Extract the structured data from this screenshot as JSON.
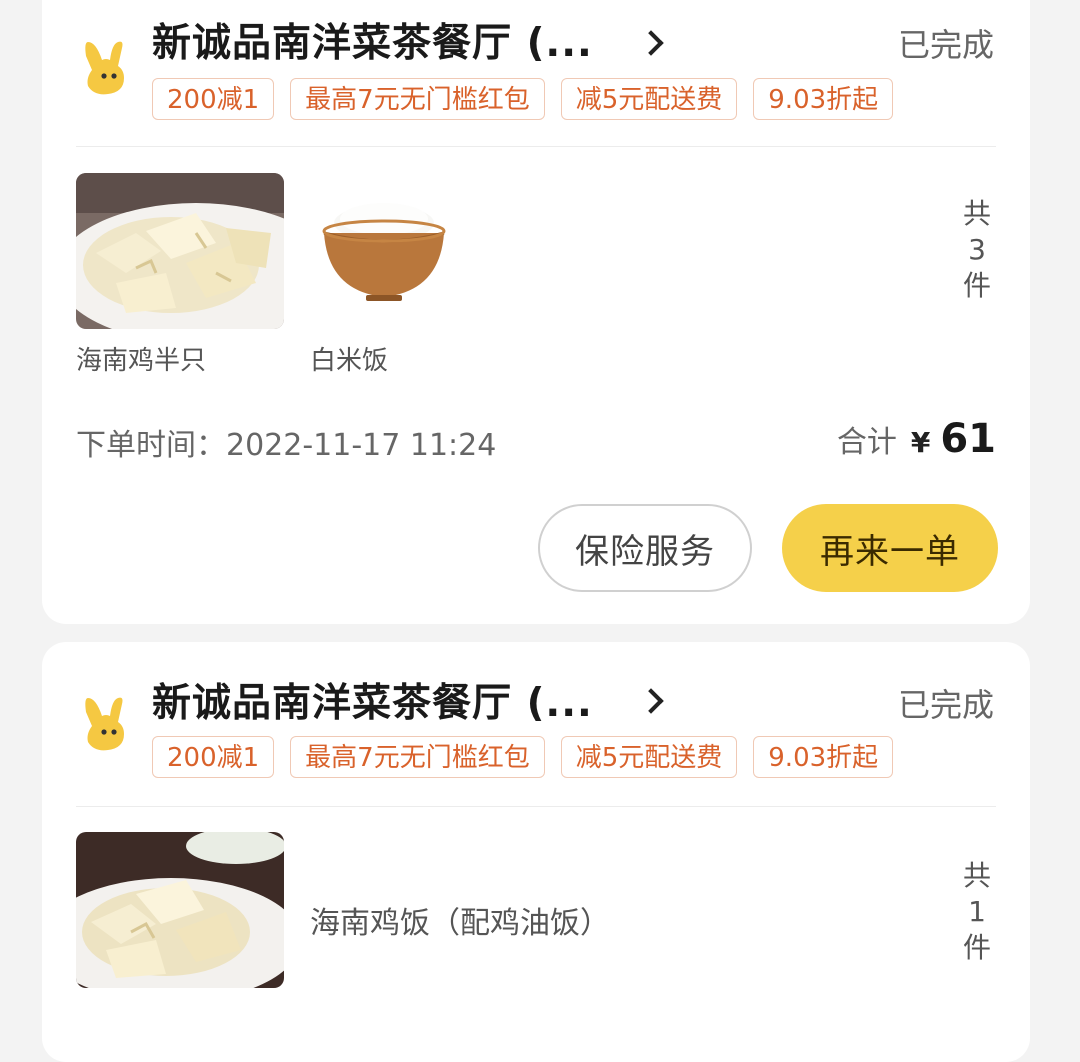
{
  "orders": [
    {
      "shop_name": "新诚品南洋菜茶餐厅 (...",
      "status": "已完成",
      "promos": [
        "200减1",
        "最高7元无门槛红包",
        "减5元配送费",
        "9.03折起"
      ],
      "items": [
        {
          "name": "海南鸡半只",
          "image": "chicken-plate"
        },
        {
          "name": "白米饭",
          "image": "rice-bowl"
        }
      ],
      "count": {
        "prefix": "共",
        "value": "3",
        "suffix": "件"
      },
      "order_time_label": "下单时间：",
      "order_time": "2022-11-17 11:24",
      "total_label": "合计",
      "currency": "¥",
      "total": "61",
      "buttons": {
        "insurance": "保险服务",
        "reorder": "再来一单"
      }
    },
    {
      "shop_name": "新诚品南洋菜茶餐厅 (...",
      "status": "已完成",
      "promos": [
        "200减1",
        "最高7元无门槛红包",
        "减5元配送费",
        "9.03折起"
      ],
      "items": [
        {
          "name": "海南鸡饭（配鸡油饭）",
          "image": "chicken-rice-plate"
        }
      ],
      "count": {
        "prefix": "共",
        "value": "1",
        "suffix": "件"
      }
    }
  ],
  "colors": {
    "accent": "#f5d04a",
    "promo": "#d9622b",
    "promo_border": "#f0c9b5",
    "logo": "#f5c842"
  },
  "icons": {
    "logo": "yellow-rabbit-logo-icon",
    "chevron": "chevron-right-icon"
  }
}
